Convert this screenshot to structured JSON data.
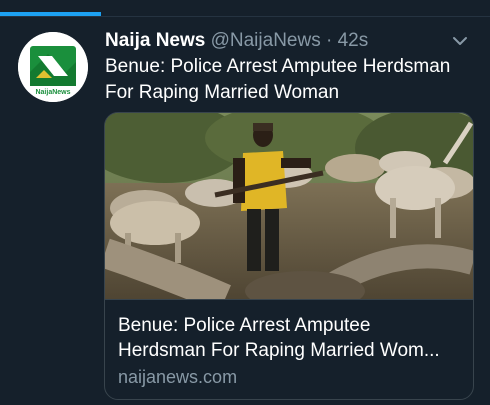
{
  "tweet": {
    "author_name": "Naija News",
    "handle": "@NaijaNews",
    "separator": "·",
    "time": "42s",
    "text": "Benue: Police Arrest Amputee Herdsman For Raping Married Woman"
  },
  "avatar": {
    "logo_text": "NaijaNews",
    "brand_color": "#1a8f3c"
  },
  "card": {
    "title_line1": "Benue: Police Arrest Amputee",
    "title_line2": "Herdsman For Raping Married Wom...",
    "domain": "naijanews.com",
    "image_description": "herdsman-with-cattle-photo"
  },
  "icons": {
    "menu": "chevron-down-icon"
  },
  "colors": {
    "background": "#15202b",
    "accent": "#1da1f2",
    "secondary_text": "#8899a6",
    "border": "#38444d"
  }
}
